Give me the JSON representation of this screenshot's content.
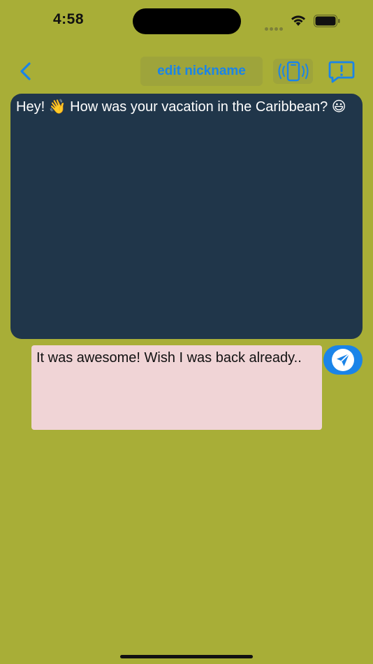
{
  "status_bar": {
    "time": "4:58",
    "icons": [
      "cellular-dots-icon",
      "wifi-icon",
      "battery-icon"
    ]
  },
  "nav": {
    "back_icon": "chevron-left-icon",
    "edit_nickname_label": "edit nickname",
    "vibrate_icon": "phone-vibrate-icon",
    "report_icon": "report-bubble-icon"
  },
  "conversation": {
    "incoming_message": "Hey! 👋 How was your vacation in the Caribbean? 😃",
    "reply_text": "It was awesome! Wish I was back already..",
    "send_icon": "paper-plane-icon"
  },
  "colors": {
    "background": "#a8ae37",
    "message_panel": "#20364a",
    "reply_box": "#f0d4d6",
    "accent": "#1a84e8"
  }
}
